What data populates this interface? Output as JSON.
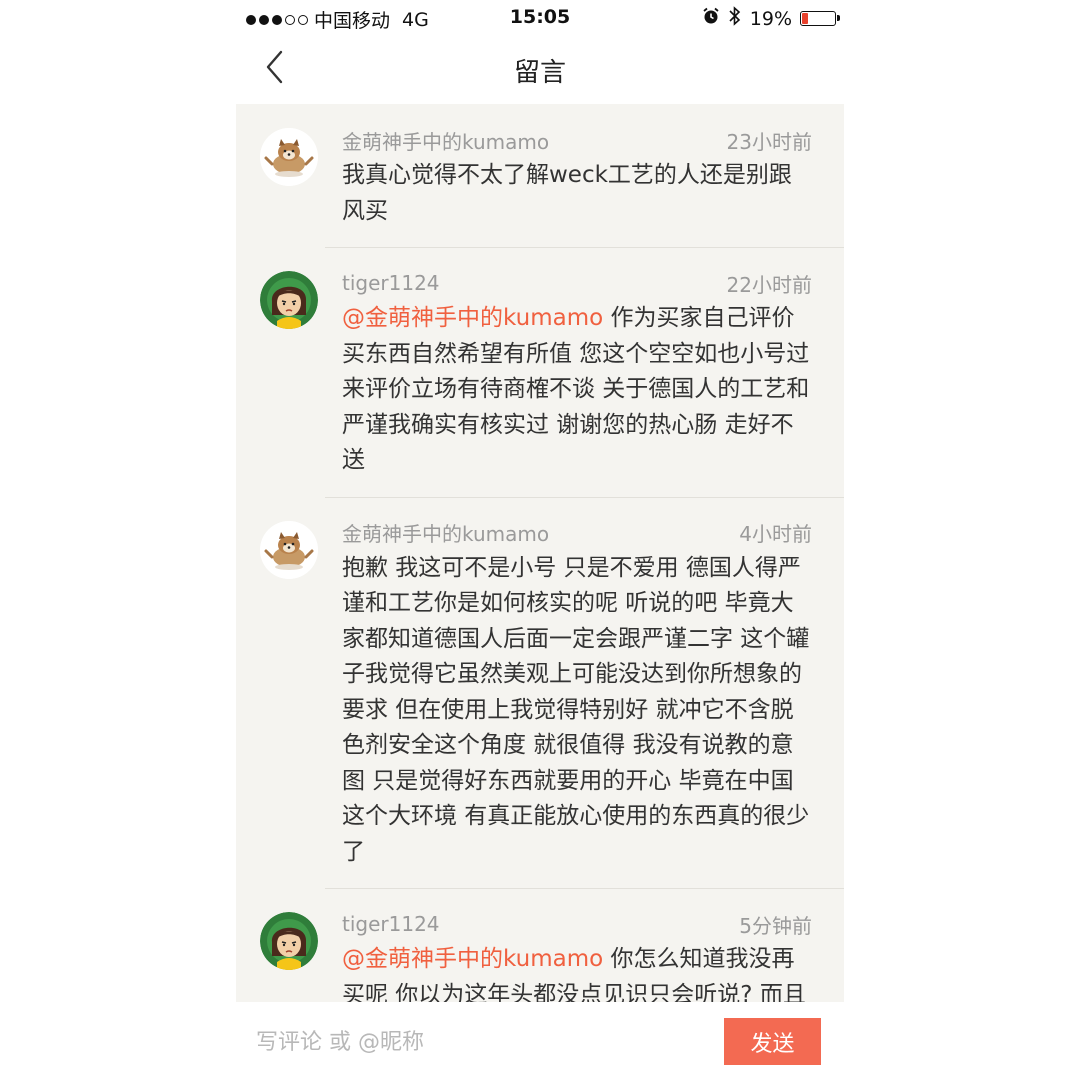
{
  "status_bar": {
    "carrier": "中国移动",
    "network": "4G",
    "time": "15:05",
    "battery": "19%",
    "battery_level": 0.19,
    "signal_bars_filled": 3,
    "signal_bars_total": 5,
    "icons": [
      "signal-dots",
      "alarm-icon",
      "bluetooth-icon",
      "battery-icon"
    ],
    "battery_color": "#e8412c"
  },
  "nav": {
    "title": "留言",
    "back_icon": "chevron-left-icon"
  },
  "colors": {
    "list_background": "#f5f4f0",
    "mention": "#f0603f",
    "send_button": "#f36a52",
    "meta_text": "#9a9a9a"
  },
  "comments": [
    {
      "avatar": "shiba-dog-avatar",
      "username": "金萌神手中的kumamo",
      "time": "23小时前",
      "mention": "",
      "text": "我真心觉得不太了解weck工艺的人还是别跟风买"
    },
    {
      "avatar": "girl-avatar",
      "username": "tiger1124",
      "time": "22小时前",
      "mention": "@金萌神手中的kumamo",
      "text": " 作为买家自己评价买东西自然希望有所值 您这个空空如也小号过来评价立场有待商榷不谈 关于德国人的工艺和严谨我确实有核实过 谢谢您的热心肠 走好不送"
    },
    {
      "avatar": "shiba-dog-avatar",
      "username": "金萌神手中的kumamo",
      "time": "4小时前",
      "mention": "",
      "text": "抱歉 我这可不是小号 只是不爱用 德国人得严谨和工艺你是如何核实的呢 听说的吧 毕竟大家都知道德国人后面一定会跟严谨二字 这个罐子我觉得它虽然美观上可能没达到你所想象的要求 但在使用上我觉得特别好 就冲它不含脱色剂安全这个角度 就很值得 我没有说教的意图 只是觉得好东西就要用的开心 毕竟在中国这个大环境 有真正能放心使用的东西真的很少了"
    },
    {
      "avatar": "girl-avatar",
      "username": "tiger1124",
      "time": "5分钟前",
      "mention": "@金萌神手中的kumamo",
      "text": " 你怎么知道我没再买呢 你以为这年头都没点见识只会听说? 而且您和"
    }
  ],
  "input_bar": {
    "placeholder": "写评论 或 @昵称",
    "value": "",
    "send_label": "发送"
  }
}
